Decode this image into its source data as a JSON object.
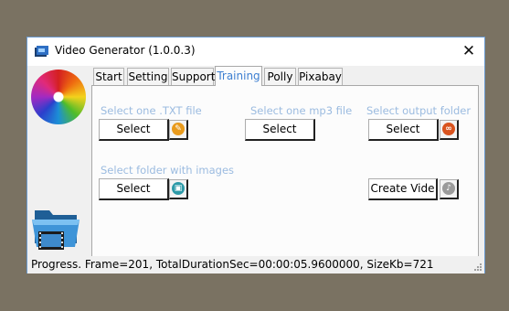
{
  "window": {
    "title": "Video Generator (1.0.0.3)",
    "close_glyph": "✕"
  },
  "tabs": [
    {
      "label": "Start"
    },
    {
      "label": "Setting"
    },
    {
      "label": "Support"
    },
    {
      "label": "Training",
      "active": true
    },
    {
      "label": "Polly"
    },
    {
      "label": "Pixabay"
    }
  ],
  "training": {
    "txt_label": "Select one .TXT file",
    "txt_button": "Select",
    "mp3_label": "Select one mp3 file",
    "mp3_button": "Select",
    "output_label": "Select output folder",
    "output_button": "Select",
    "images_label": "Select folder with images",
    "images_button": "Select",
    "create_button": "Create Vide"
  },
  "status": {
    "text": "Progress. Frame=201, TotalDurationSec=00:00:05.9600000, SizeKb=721"
  },
  "colors": {
    "accent": "#3d7fd1",
    "label": "#9bbbe0",
    "pencil_icon": "#e89a1c",
    "link_icon": "#d9531e",
    "image_icon": "#2d9aa8",
    "music_icon": "#9a9a9a"
  },
  "icons": [
    "app-icon",
    "swirl-logo",
    "video-folder-icon",
    "pencil-icon",
    "link-icon",
    "image-folder-icon",
    "music-note-icon",
    "resize-grip-icon"
  ]
}
